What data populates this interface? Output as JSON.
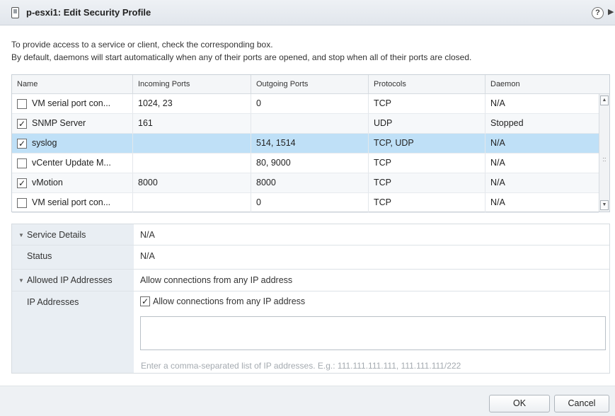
{
  "dialog": {
    "title": "p-esxi1: Edit Security Profile",
    "help_glyph": "?",
    "expand_glyph": "▶"
  },
  "description": {
    "line1": "To provide access to a service or client, check the corresponding box.",
    "line2": "By default, daemons will start automatically when any of their ports are opened, and stop when all of their ports are closed."
  },
  "grid": {
    "columns": [
      "Name",
      "Incoming Ports",
      "Outgoing Ports",
      "Protocols",
      "Daemon"
    ],
    "rows": [
      {
        "checked": "",
        "name": "VM serial port con...",
        "incoming": "1024, 23",
        "outgoing": "0",
        "protocols": "TCP",
        "daemon": "N/A"
      },
      {
        "checked": "✓",
        "name": "SNMP Server",
        "incoming": "161",
        "outgoing": "",
        "protocols": "UDP",
        "daemon": "Stopped"
      },
      {
        "checked": "✓",
        "name": "syslog",
        "incoming": "",
        "outgoing": "514, 1514",
        "protocols": "TCP, UDP",
        "daemon": "N/A"
      },
      {
        "checked": "",
        "name": "vCenter Update M...",
        "incoming": "",
        "outgoing": "80, 9000",
        "protocols": "TCP",
        "daemon": "N/A"
      },
      {
        "checked": "✓",
        "name": "vMotion",
        "incoming": "8000",
        "outgoing": "8000",
        "protocols": "TCP",
        "daemon": "N/A"
      },
      {
        "checked": "",
        "name": "VM serial port con...",
        "incoming": "",
        "outgoing": "0",
        "protocols": "TCP",
        "daemon": "N/A"
      }
    ],
    "selected_row": "syslog",
    "selected_color": "#bfe0f7"
  },
  "details": {
    "service_details_label": "Service Details",
    "service_details_value": "N/A",
    "status_label": "Status",
    "status_value": "N/A",
    "allowed_ip_label": "Allowed IP Addresses",
    "allowed_ip_value": "Allow connections from any IP address",
    "ip_addresses_label": "IP Addresses",
    "allow_any_checked": "✓",
    "allow_any_label": "Allow connections from any IP address",
    "ip_input_value": "",
    "ip_hint": "Enter a comma-separated list of IP addresses. E.g.: 111.111.111.111, 111.111.111/222"
  },
  "footer": {
    "ok_label": "OK",
    "cancel_label": "Cancel"
  }
}
